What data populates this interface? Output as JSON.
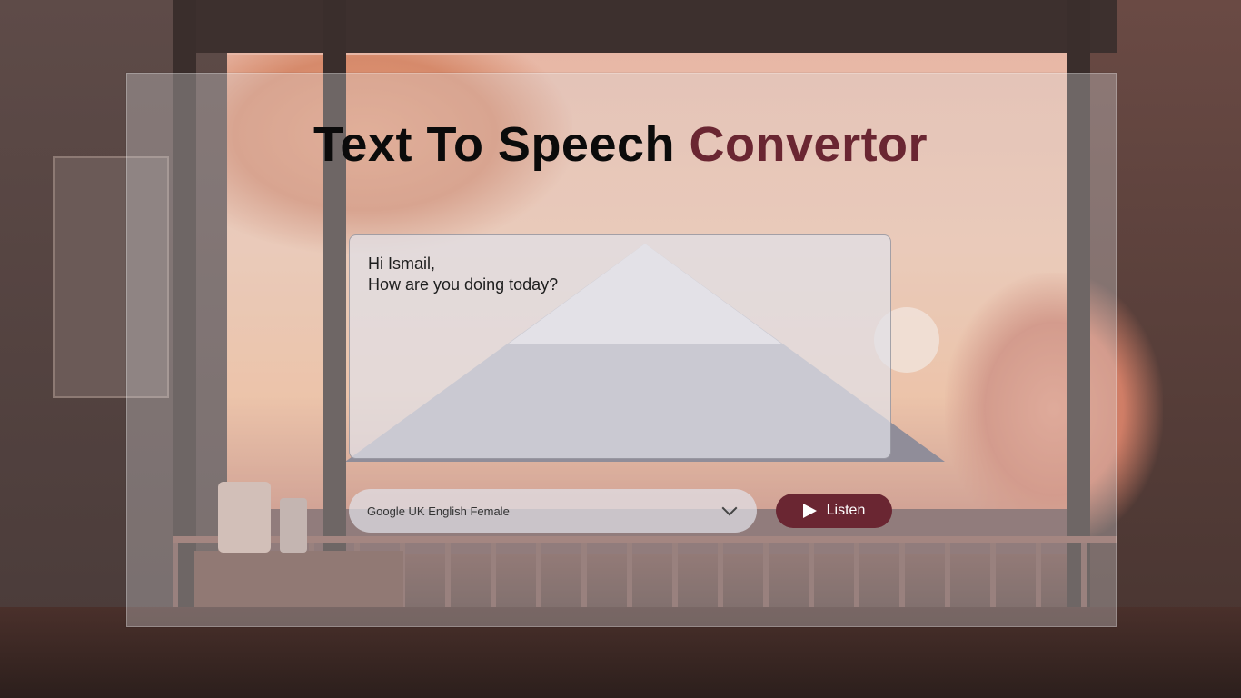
{
  "app": {
    "title_main": "Text To Speech ",
    "title_accent": "Convertor",
    "accent_color": "#6a2632"
  },
  "editor": {
    "text": "Hi Ismail,\nHow are you doing today?"
  },
  "voice": {
    "selected": "Google UK English Female",
    "icon": "chevron-down-icon"
  },
  "listen": {
    "label": "Listen",
    "icon": "play-icon"
  }
}
